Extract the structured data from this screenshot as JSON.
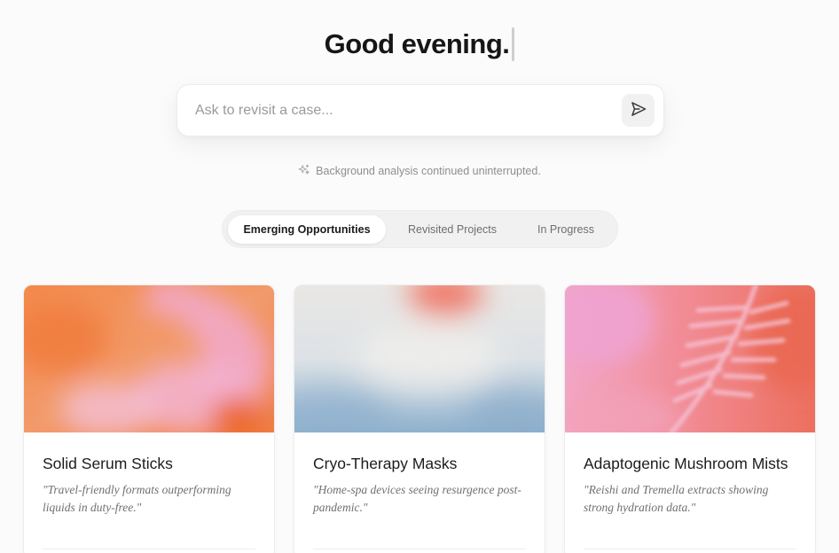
{
  "greeting": {
    "text": "Good evening."
  },
  "search": {
    "placeholder": "Ask to revisit a case..."
  },
  "status": {
    "text": "Background analysis continued uninterrupted."
  },
  "tabs": [
    {
      "label": "Emerging Opportunities",
      "active": true
    },
    {
      "label": "Revisited Projects",
      "active": false
    },
    {
      "label": "In Progress",
      "active": false
    }
  ],
  "cards": [
    {
      "title": "Solid Serum Sticks",
      "quote": "\"Travel-friendly formats outperforming liquids in duty-free.\""
    },
    {
      "title": "Cryo-Therapy Masks",
      "quote": "\"Home-spa devices seeing resurgence post-pandemic.\""
    },
    {
      "title": "Adaptogenic Mushroom Mists",
      "quote": "\"Reishi and Tremella extracts showing strong hydration data.\""
    }
  ],
  "icons": {
    "send": "send-icon",
    "status": "sparkle-icon"
  }
}
